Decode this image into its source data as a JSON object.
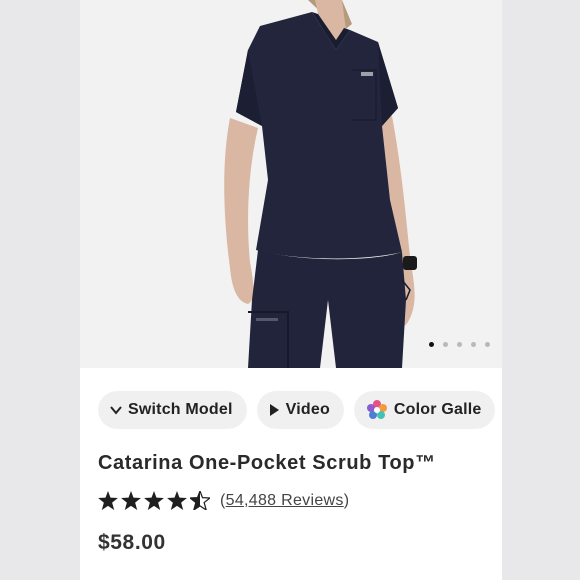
{
  "product": {
    "title": "Catarina One-Pocket Scrub Top™",
    "rating": 4.5,
    "reviews_open": "(",
    "reviews_count": "54,488 Reviews",
    "reviews_close": ")",
    "price": "$58.00"
  },
  "gallery": {
    "image_alt": "Model wearing navy scrub top and pants",
    "dot_count": 5,
    "active_dot": 0
  },
  "actions": {
    "switch_model": "Switch Model",
    "video": "Video",
    "color_gallery": "Color Galle"
  },
  "colors": {
    "scrub_navy": "#23253d",
    "price": "#333333",
    "chip_bg": "#f0f0f0"
  },
  "icons": {
    "switch_model": "chevron-down-icon",
    "video": "play-icon",
    "color_gallery": "color-wheel-icon",
    "star": "star-icon"
  }
}
